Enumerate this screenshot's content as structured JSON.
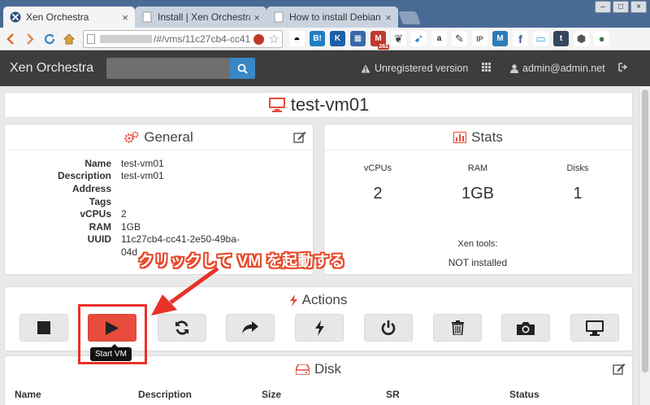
{
  "browser": {
    "tabs": [
      {
        "title": "Xen Orchestra",
        "active": true
      },
      {
        "title": "Install | Xen Orchestra",
        "active": false
      },
      {
        "title": "How to install Debian Se",
        "active": false
      }
    ],
    "url": "/#/vms/11c27cb4-cc41",
    "tab_close": "×",
    "window_buttons": [
      "–",
      "□",
      "×"
    ],
    "ext_badge": "262"
  },
  "xo": {
    "brand": "Xen Orchestra",
    "search_placeholder": "",
    "unregistered": "Unregistered version",
    "user": "admin@admin.net"
  },
  "vm": {
    "name": "test-vm01"
  },
  "general": {
    "title": "General",
    "props": [
      {
        "label": "Name",
        "value": "test-vm01"
      },
      {
        "label": "Description",
        "value": "test-vm01"
      },
      {
        "label": "Address",
        "value": ""
      },
      {
        "label": "Tags",
        "value": ""
      },
      {
        "label": "vCPUs",
        "value": "2"
      },
      {
        "label": "RAM",
        "value": "1GB"
      },
      {
        "label": "UUID",
        "value": "11c27cb4-cc41-2e50-49ba-"
      },
      {
        "label": "",
        "value": "04d"
      }
    ]
  },
  "stats": {
    "title": "Stats",
    "vcpus_label": "vCPUs",
    "vcpus": "2",
    "ram_label": "RAM",
    "ram": "1GB",
    "disks_label": "Disks",
    "disks": "1",
    "xentools_label": "Xen tools:",
    "xentools_value": "NOT installed"
  },
  "actions": {
    "title": "Actions",
    "tooltip": "Start VM"
  },
  "disk": {
    "title": "Disk",
    "columns": [
      "Name",
      "Description",
      "Size",
      "SR",
      "Status"
    ]
  },
  "annotation": {
    "callout": "クリックして VM を起動する"
  },
  "colors": {
    "accent_red": "#e74c3c",
    "nav_bg": "#3d3d3d",
    "search_blue": "#3a87c6"
  }
}
